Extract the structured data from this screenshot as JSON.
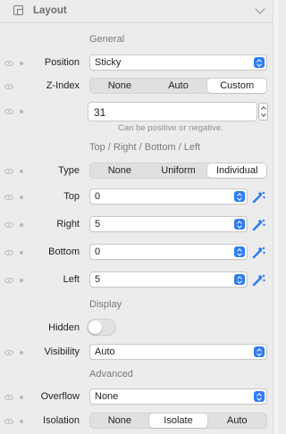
{
  "header": {
    "title": "Layout",
    "icon": "layout-icon",
    "chevron": "chevron-down-icon"
  },
  "sections": {
    "general": "General",
    "sides": "Top / Right / Bottom / Left",
    "display": "Display",
    "advanced": "Advanced"
  },
  "position": {
    "label": "Position",
    "value": "Sticky"
  },
  "zindex": {
    "label": "Z-Index",
    "options": [
      "None",
      "Auto",
      "Custom"
    ],
    "selected": "Custom",
    "value": "31",
    "hint": "Can be positive or negative."
  },
  "type": {
    "label": "Type",
    "options": [
      "None",
      "Uniform",
      "Individual"
    ],
    "selected": "Individual"
  },
  "top": {
    "label": "Top",
    "value": "0"
  },
  "right": {
    "label": "Right",
    "value": "5"
  },
  "bottom": {
    "label": "Bottom",
    "value": "0"
  },
  "left": {
    "label": "Left",
    "value": "5"
  },
  "hidden": {
    "label": "Hidden",
    "checked": false
  },
  "visibility": {
    "label": "Visibility",
    "value": "Auto"
  },
  "overflow": {
    "label": "Overflow",
    "value": "None"
  },
  "isolation": {
    "label": "Isolation",
    "options": [
      "None",
      "Isolate",
      "Auto"
    ],
    "selected": "Isolate"
  },
  "colors": {
    "accent": "#2f7cf6",
    "background": "#ececec"
  }
}
